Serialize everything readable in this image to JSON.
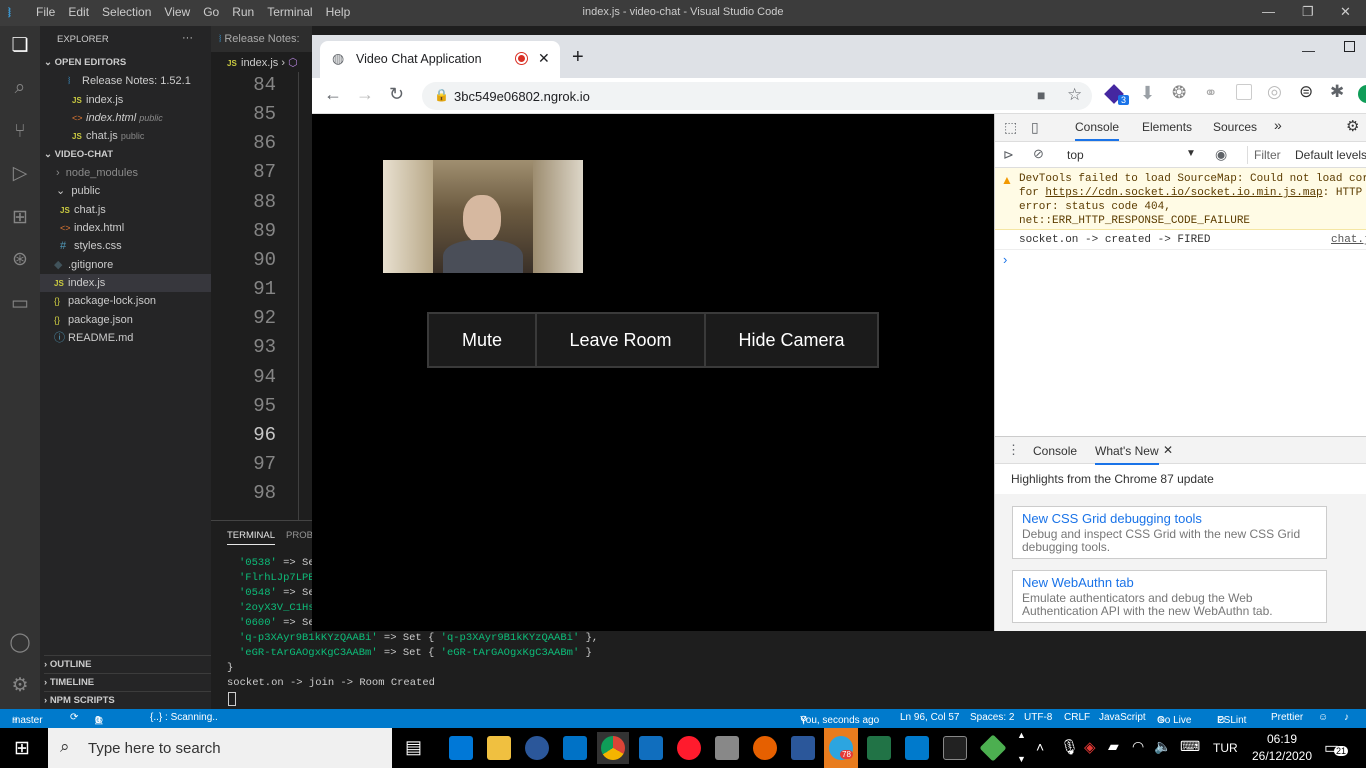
{
  "vscode": {
    "title": "index.js - video-chat - Visual Studio Code",
    "menu": [
      "File",
      "Edit",
      "Selection",
      "View",
      "Go",
      "Run",
      "Terminal",
      "Help"
    ],
    "explorer_title": "EXPLORER",
    "open_editors_label": "OPEN EDITORS",
    "open_editors": [
      {
        "name": "Release Notes: 1.52.1",
        "desc": ""
      },
      {
        "name": "index.js",
        "desc": ""
      },
      {
        "name": "index.html",
        "desc": "public"
      },
      {
        "name": "chat.js",
        "desc": "public"
      }
    ],
    "project_label": "VIDEO-CHAT",
    "tree": {
      "node_modules": "node_modules",
      "public": "public",
      "chat_js": "chat.js",
      "index_html": "index.html",
      "styles_css": "styles.css",
      "gitignore": ".gitignore",
      "index_js": "index.js",
      "package_lock": "package-lock.json",
      "package_json": "package.json",
      "readme": "README.md"
    },
    "outline": "OUTLINE",
    "timeline": "TIMELINE",
    "npm_scripts": "NPM SCRIPTS",
    "tab_release_notes": "Release Notes:",
    "breadcrumb_file": "index.js",
    "line_numbers": [
      "84",
      "85",
      "86",
      "87",
      "88",
      "89",
      "90",
      "91",
      "92",
      "93",
      "94",
      "95",
      "96",
      "97",
      "98"
    ],
    "terminal_tab": "TERMINAL",
    "problems_tab": "PROBL",
    "terminal_lines": [
      {
        "a": "'0538'",
        "b": " => Se"
      },
      {
        "a": "'FlrhLJp7LPE",
        "b": ""
      },
      {
        "a": "'0548'",
        "b": " => Se"
      },
      {
        "a": "'2oyX3V_C1Hs",
        "b": ""
      },
      {
        "a": "'0600'",
        "b": " => Se"
      }
    ],
    "terminal_full_1a": "'q-p3XAyr9B1kKYzQAABi'",
    "terminal_full_1b": " => Set { ",
    "terminal_full_1c": "'q-p3XAyr9B1kKYzQAABi'",
    "terminal_full_1d": " },",
    "terminal_full_2a": "'eGR-tArGAOgxKgC3AABm'",
    "terminal_full_2b": " => Set { ",
    "terminal_full_2c": "'eGR-tArGAOgxKgC3AABm'",
    "terminal_full_2d": " }",
    "terminal_brace": "}",
    "terminal_last": "socket.on -> join -> Room Created",
    "status": {
      "branch": "master",
      "errors": "0",
      "warnings": "0",
      "scanning": "{..} : Scanning..",
      "blame": "You, seconds ago",
      "position": "Ln 96, Col 57",
      "spaces": "Spaces: 2",
      "encoding": "UTF-8",
      "eol": "CRLF",
      "language": "JavaScript",
      "golive": "Go Live",
      "eslint": "ESLint",
      "prettier": "Prettier"
    }
  },
  "chrome": {
    "tab_title": "Video Chat Application",
    "url": "3bc549e06802.ngrok.io",
    "extension_badge": "3",
    "page": {
      "buttons": [
        "Mute",
        "Leave Room",
        "Hide Camera"
      ]
    },
    "devtools": {
      "tabs": [
        "Console",
        "Elements",
        "Sources"
      ],
      "context": "top",
      "filter_placeholder": "Filter",
      "levels": "Default levels",
      "warning_line1": "DevTools failed to load SourceMap: Could not load cor",
      "warning_line2_pre": "for ",
      "warning_link": "https://cdn.socket.io/socket.io.min.js.map",
      "warning_line2_post": ": HTTP",
      "warning_line3": "error: status code 404,",
      "warning_line4": "net::ERR_HTTP_RESPONSE_CODE_FAILURE",
      "log_message": "socket.on -> created -> FIRED",
      "log_source": "chat.j",
      "drawer_tabs": [
        "Console",
        "What's New"
      ],
      "highlights": "Highlights from the Chrome 87 update",
      "cards": [
        {
          "title": "New CSS Grid debugging tools",
          "desc": "Debug and inspect CSS Grid with the new CSS Grid debugging tools."
        },
        {
          "title": "New WebAuthn tab",
          "desc": "Emulate authenticators and debug the Web Authentication API with the new WebAuthn tab."
        }
      ]
    }
  },
  "taskbar": {
    "search_placeholder": "Type here to search",
    "language": "TUR",
    "time": "06:19",
    "date": "26/12/2020",
    "notification_count": "21",
    "telegram_badge": "78"
  },
  "colors": {
    "vscode_blue": "#007acc",
    "chrome_tab_bg": "#dee1e6",
    "devtools_warning_bg": "#fffbe5",
    "link_blue": "#1a73e8"
  }
}
